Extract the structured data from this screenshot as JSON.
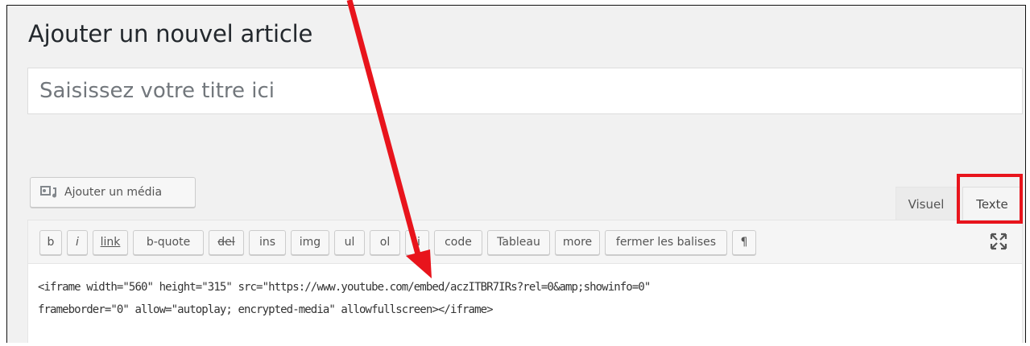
{
  "page": {
    "title": "Ajouter un nouvel article"
  },
  "title_field": {
    "placeholder": "Saisissez votre titre ici"
  },
  "media": {
    "add_label": "Ajouter un média"
  },
  "tabs": {
    "visual": "Visuel",
    "text": "Texte",
    "active": "text"
  },
  "toolbar": {
    "buttons": [
      "b",
      "i",
      "link",
      "b-quote",
      "del",
      "ins",
      "img",
      "ul",
      "ol",
      "li",
      "code",
      "Tableau",
      "more",
      "fermer les balises",
      "¶"
    ]
  },
  "editor": {
    "line1": "<iframe width=\"560\" height=\"315\" src=\"https://www.youtube.com/embed/aczITBR7IRs?rel=0&amp;showinfo=0\"",
    "line2": "frameborder=\"0\" allow=\"autoplay; encrypted-media\" allowfullscreen></iframe>"
  },
  "annotations": {
    "highlight_color": "#e8141c",
    "arrow_color": "#e8141c"
  },
  "icons": {
    "media": "media-icon",
    "fullscreen": "fullscreen-icon"
  }
}
